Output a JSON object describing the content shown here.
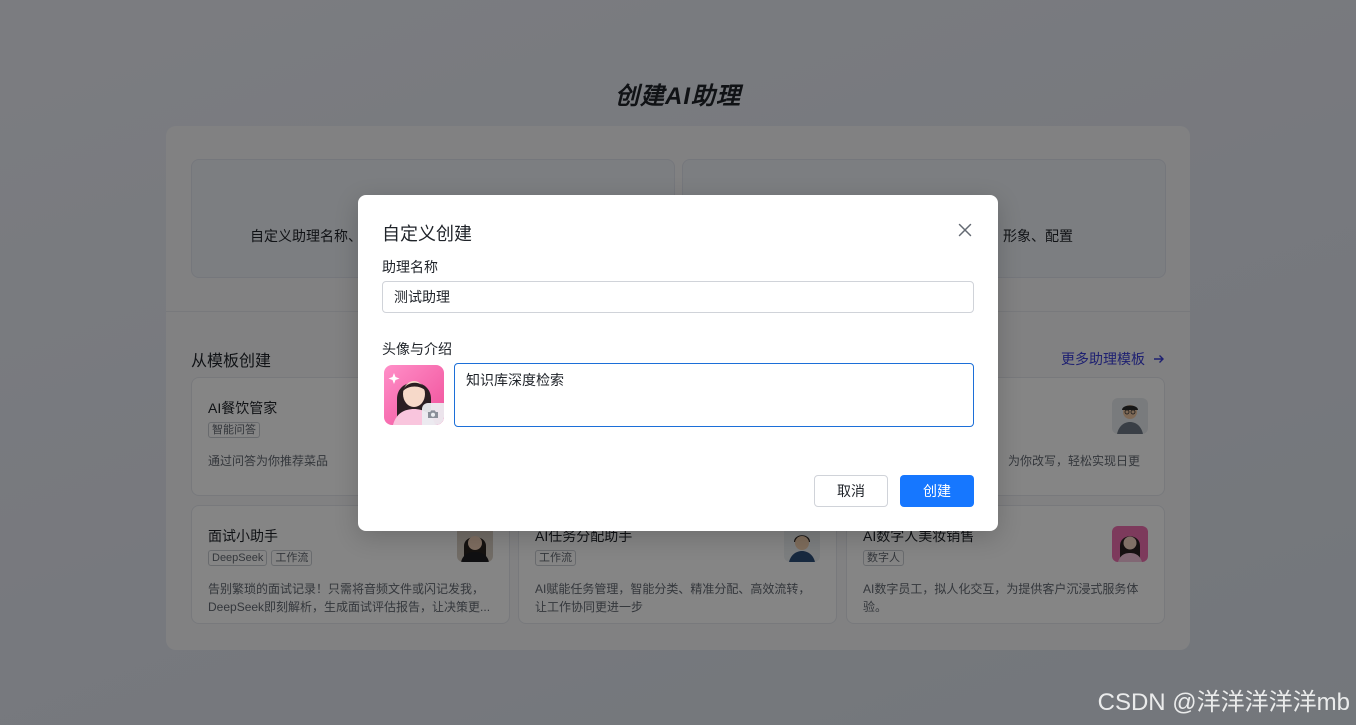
{
  "page": {
    "title": "创建AI助理"
  },
  "background": {
    "option_left_desc": "自定义助理名称、",
    "option_right_desc": "形象、配置",
    "templates_title": "从模板创建",
    "more_templates": "更多助理模板",
    "templates": [
      {
        "name": "AI餐饮管家",
        "tags": [
          "智能问答"
        ],
        "desc": "通过问答为你推荐菜品"
      },
      {
        "name": "",
        "tags": [],
        "desc": ""
      },
      {
        "name": "",
        "tags": [],
        "desc": "为你改写，轻松实现日更"
      },
      {
        "name": "面试小助手",
        "tags": [
          "DeepSeek",
          "工作流"
        ],
        "desc": "告别繁琐的面试记录！只需将音频文件或闪记发我，DeepSeek即刻解析，生成面试评估报告，让决策更..."
      },
      {
        "name": "AI任务分配助手",
        "tags": [
          "工作流"
        ],
        "desc": "AI赋能任务管理，智能分类、精准分配、高效流转，让工作协同更进一步"
      },
      {
        "name": "AI数字人美妆销售",
        "tags": [
          "数字人"
        ],
        "desc": "AI数字员工，拟人化交互，为提供客户沉浸式服务体验。"
      }
    ]
  },
  "modal": {
    "title": "自定义创建",
    "name_label": "助理名称",
    "name_value": "测试助理",
    "intro_label": "头像与介绍",
    "intro_value": "知识库深度检索",
    "cancel_label": "取消",
    "create_label": "创建"
  },
  "colors": {
    "primary": "#1677ff",
    "link": "#3b3fd8",
    "focus_border": "#1c6fd8"
  },
  "icons": {
    "close": "close-icon",
    "camera": "camera-icon",
    "arrow": "arrow-right-icon"
  },
  "watermark": "CSDN @洋洋洋洋洋mb"
}
